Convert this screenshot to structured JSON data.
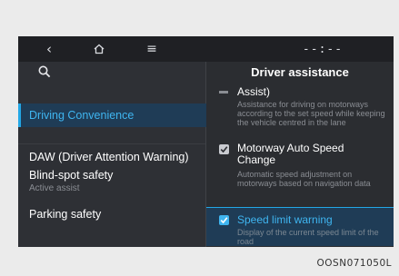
{
  "topbar": {
    "back_icon": "chevron-left-icon",
    "home_icon": "home-icon",
    "menu_icon": "menu-icon",
    "time": "--:--"
  },
  "left_menu": {
    "search_icon": "search-icon",
    "items": [
      {
        "label": "Driving Convenience",
        "active": true
      },
      {
        "label": "DAW (Driver Attention Warning)"
      },
      {
        "label": "Blind-spot safety",
        "sub": "Active assist"
      },
      {
        "label": "Parking safety"
      }
    ]
  },
  "right_panel": {
    "title": "Driver assistance",
    "options": [
      {
        "label": "Assist)",
        "desc": "Assistance for driving on motorways according to the set speed while keeping the vehicle centred in the lane"
      },
      {
        "label": "Motorway Auto Speed Change",
        "desc": "Automatic speed adjustment on motorways based on navigation data",
        "checked": true
      },
      {
        "label": "Speed limit warning",
        "desc": "Display of the current speed limit of the road",
        "checked": true,
        "highlighted": true
      }
    ]
  },
  "caption": "OOSN071050L",
  "colors": {
    "accent": "#3fb5f0",
    "active_bg": "#1f3c56",
    "screen_bg": "#2b2d31"
  }
}
